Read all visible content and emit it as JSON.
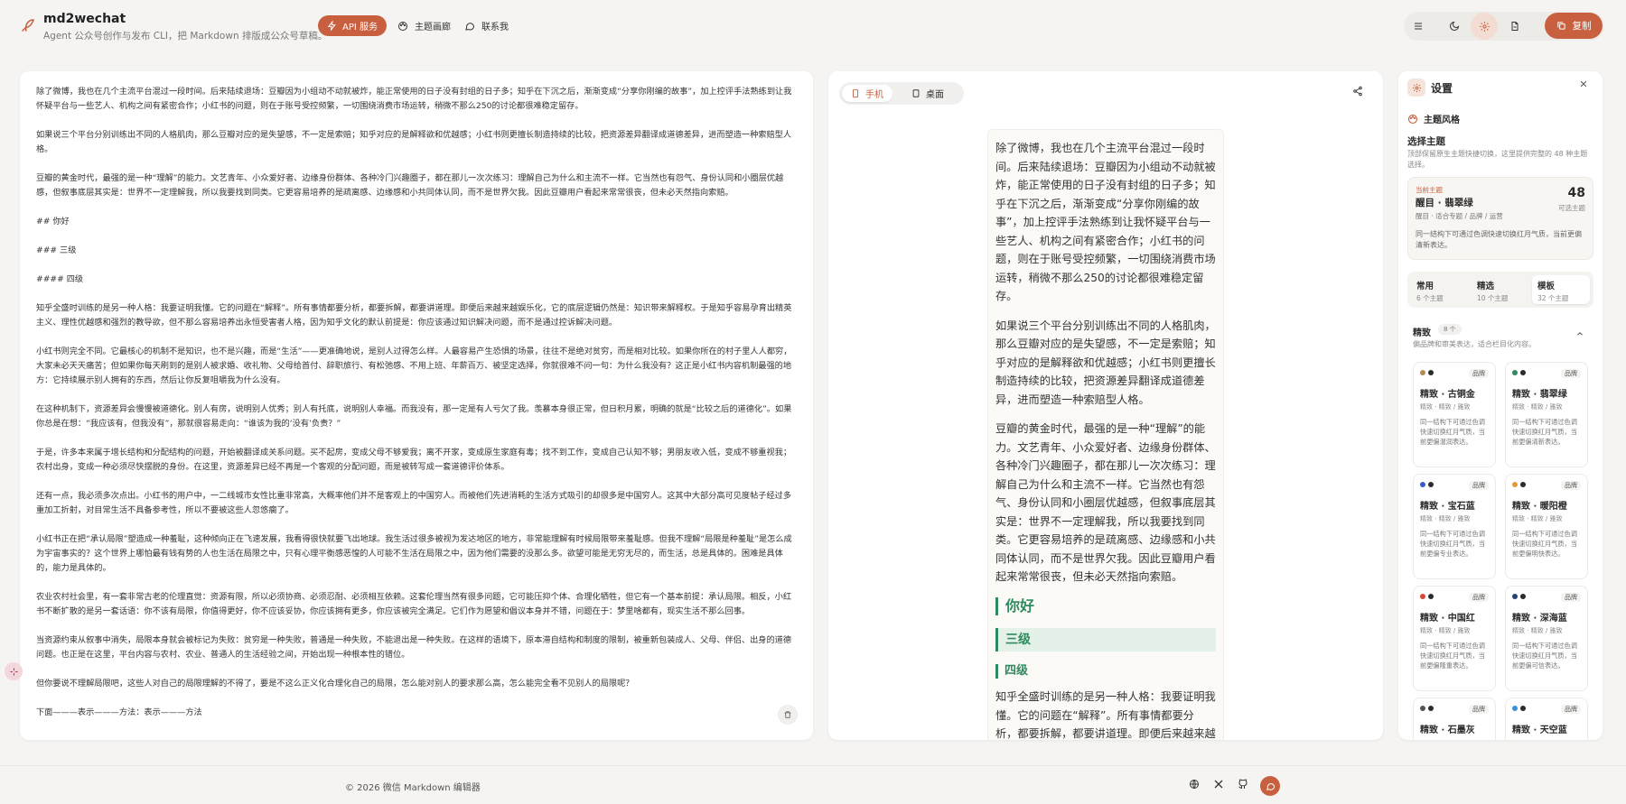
{
  "app": {
    "title": "md2wechat",
    "subtitle": "Agent 公众号创作与发布 CLI，把 Markdown 排版成公众号草稿。"
  },
  "nav": {
    "api": "API 服务",
    "theme_gallery": "主题画廊",
    "contact": "联系我"
  },
  "toolbar": {
    "copy": "复制",
    "icons": [
      "menu-icon",
      "moon-icon",
      "gear-icon",
      "file-icon",
      "copy-icon"
    ]
  },
  "editor": {
    "paragraphs": [
      "除了微博，我也在几个主流平台混过一段时间。后来陆续退场：豆瓣因为小组动不动就被炸，能正常使用的日子没有封组的日子多；知乎在下沉之后，渐渐变成“分享你刚编的故事”，加上控评手法熟练到让我怀疑平台与一些艺人、机构之间有紧密合作；小红书的问题，则在于账号受控频繁，一切围绕消费市场运转，稍微不那么250的讨论都很难稳定留存。",
      "如果说三个平台分别训练出不同的人格肌肉，那么豆瓣对应的是失望感，不一定是索赔；知乎对应的是解释欲和优越感；小红书则更擅长制造持续的比较，把资源差异翻译成道德差异，进而塑造一种索赔型人格。",
      "豆瓣的黄金时代，最强的是一种“理解”的能力。文艺青年、小众爱好者、边缘身份群体、各种冷门兴趣圈子，都在那儿一次次练习：理解自己为什么和主流不一样。它当然也有怨气、身份认同和小圈层优越感，但叙事底层其实是：世界不一定理解我，所以我要找到同类。它更容易培养的是疏离感、边缘感和小共同体认同，而不是世界欠我。因此豆瓣用户看起来常常很丧，但未必天然指向索赔。",
      "## 你好",
      "### 三级",
      "#### 四级",
      "知乎全盛时训练的是另一种人格：我要证明我懂。它的问题在“解释”。所有事情都要分析，都要拆解，都要讲道理。即便后来越来越娱乐化，它的底层逻辑仍然是：知识带来解释权。于是知乎容易孕育出精英主义、理性优越感和强烈的教导欲，但不那么容易培养出永恒受害者人格，因为知乎文化的默认前提是：你应该通过知识解决问题，而不是通过控诉解决问题。",
      "小红书则完全不同。它最核心的机制不是知识，也不是兴趣，而是“生活”——更准确地说，是别人过得怎么样。人最容易产生恐惧的场景，往往不是绝对贫穷，而是相对比较。如果你所在的村子里人人都穷，大家未必天天痛苦；但如果你每天刷到的是别人被求婚、收礼物、父母给首付、辞职旅行、有松弛感、不用上班、年薪百万、被坚定选择，你就很难不问一句：为什么我没有？这正是小红书内容机制最强的地方：它持续展示别人拥有的东西，然后让你反复咀嚼我为什么没有。",
      "在这种机制下，资源差异会慢慢被道德化。别人有房，说明别人优秀；别人有托底，说明别人幸福。而我没有，那一定是有人亏欠了我。羡慕本身很正常，但日积月累，明确的就是“比较之后的道德化”。如果你总是在想：“我应该有，但我没有”，那就很容易走向：“谁该为我的‘没有’负责？”",
      "于是，许多本来属于增长结构和分配结构的问题，开始被翻译成关系问题。买不起房，变成父母不够爱我；离不开家，变成原生家庭有毒；找不到工作，变成自己认知不够；男朋友收入低，变成不够重视我；农村出身，变成一种必须尽快摆脱的身份。在这里，资源差异已经不再是一个客观的分配问题，而是被转写成一套道德评价体系。",
      "还有一点，我必须多次点出。小红书的用户中，一二线城市女性比重非常高，大概率他们并不是客观上的中国穷人。而被他们先进消耗的生活方式吸引的却很多是中国穷人。这其中大部分高可见度帖子经过多重加工折射，对目常生活不具备参考性，所以不要被这些人忽悠瘸了。",
      "小红书正在把“承认局限”塑造成一种羞耻，这种倾向正在飞速发展，我看得很快就要飞出地球。我生活过很多被视为发达地区的地方，非常能理解有时候局限带来羞耻感。但我不理解“局限是种羞耻”是怎么成为宇宙事实的？这个世界上哪怕最有钱有势的人也生活在局限之中，只有心理平衡感恶惶的人可能不生活在局限之中，因为他们需要的没那么多。欲望可能是无穷无尽的，而生活，总是具体的。困难是具体的，能力是具体的。",
      "农业农村社会里，有一套非常古老的伦理直觉：资源有限，所以必须协商、必须忍耐、必须相互依赖。这套伦理当然有很多问题，它可能压抑个体、合理化牺牲，但它有一个基本前提：承认局限。相反，小红书不断扩散的是另一套话语：你不该有局限，你值得更好，你不应该妥协，你应该拥有更多，你应该被完全满足。它们作为愿望和倡议本身并不错，问题在于：梦里啥都有，现实生活不那么回事。",
      "当资源约束从叙事中消失，局限本身就会被标记为失败：贫穷是一种失败，普通是一种失败，不能退出是一种失败。在这样的语境下，原本滞自结构和制度的限制，被重新包装成人、父母、伴侣、出身的道德问题。也正是在这里，平台内容与农村、农业、普通人的生活经验之间，开始出现一种根本性的错位。",
      "但你要说不理解局限吧，这些人对自己的局限理解的不得了，要是不这么正义化合理化自己的局限，怎么能对别人的要求那么高，怎么能完全看不见别人的局限呢？",
      "下面———表示———方法：表示———方法"
    ]
  },
  "preview": {
    "device_mobile": "手机",
    "device_desktop": "桌面",
    "paragraphs_top": [
      "除了微博，我也在几个主流平台混过一段时间。后来陆续退场：豆瓣因为小组动不动就被炸，能正常使用的日子没有封组的日子多；知乎在下沉之后，渐渐变成“分享你刚编的故事”，加上控评手法熟练到让我怀疑平台与一些艺人、机构之间有紧密合作；小红书的问题，则在于账号受控频繁，一切围绕消费市场运转，稍微不那么250的讨论都很难稳定留存。",
      "如果说三个平台分别训练出不同的人格肌肉，那么豆瓣对应的是失望感，不一定是索赔；知乎对应的是解释欲和优越感；小红书则更擅长制造持续的比较，把资源差异翻译成道德差异，进而塑造一种索赔型人格。",
      "豆瓣的黄金时代，最强的是一种“理解”的能力。文艺青年、小众爱好者、边缘身份群体、各种冷门兴趣圈子，都在那儿一次次练习：理解自己为什么和主流不一样。它当然也有怨气、身份认同和小圈层优越感，但叙事底层其实是：世界不一定理解我，所以我要找到同类。它更容易培养的是疏离感、边缘感和小共同体认同，而不是世界欠我。因此豆瓣用户看起来常常很丧，但未必天然指向索赔。"
    ],
    "h2": "你好",
    "h3": "三级",
    "h4": "四级",
    "paragraph_after": "知乎全盛时训练的是另一种人格：我要证明我懂。它的问题在“解释”。所有事情都要分析，都要拆解，都要讲道理。即便后来越来越娱乐化，它的底层逻辑仍然是：知识带来解释权。于是知乎容易孕育出精英主义、理性优越感和强烈的教导欲"
  },
  "settings": {
    "title": "设置",
    "section_title": "主题风格",
    "choose_title": "选择主题",
    "choose_desc": "顶部保留原生主题快捷切换，这里提供完整的 48 种主题选择。",
    "current": {
      "label": "当前主题",
      "name": "醒目 · 翡翠绿",
      "meta": "醒目 · 适合专题 / 品牌 / 运营",
      "count": "48",
      "count_label": "可选主题",
      "desc": "同一结构下可通过色调快速切换红月气质，当前更偏清新表达。"
    },
    "tabs": [
      {
        "label": "常用",
        "count": "6 个主题"
      },
      {
        "label": "精选",
        "count": "10 个主题"
      },
      {
        "label": "模板",
        "count": "32 个主题"
      }
    ],
    "group": {
      "title": "精致",
      "count": "8 个",
      "desc": "偏品牌和审美表达，适合栏目化内容。"
    },
    "cards": [
      {
        "name": "精致 · 古铜金",
        "badge": "品牌",
        "meta": "精致 · 精致 / 雅致",
        "desc": "同一结构下可通过色调快速切换红月气质，当前更偏温润表达。",
        "c1": "#b48a55",
        "c2": "#2b2b2b"
      },
      {
        "name": "精致 · 翡翠绿",
        "badge": "品牌",
        "meta": "精致 · 精致 / 雅致",
        "desc": "同一结构下可通过色调快速切换红月气质，当前更偏清新表达。",
        "c1": "#2f8a5f",
        "c2": "#2b2b2b"
      },
      {
        "name": "精致 · 宝石蓝",
        "badge": "品牌",
        "meta": "精致 · 精致 / 雅致",
        "desc": "同一结构下可通过色调快速切换红月气质，当前更偏专业表达。",
        "c1": "#3a5bc7",
        "c2": "#2b2b2b"
      },
      {
        "name": "精致 · 暖阳橙",
        "badge": "品牌",
        "meta": "精致 · 精致 / 雅致",
        "desc": "同一结构下可通过色调快速切换红月气质，当前更偏明快表达。",
        "c1": "#e39a3b",
        "c2": "#2b2b2b"
      },
      {
        "name": "精致 · 中国红",
        "badge": "品牌",
        "meta": "精致 · 精致 / 雅致",
        "desc": "同一结构下可通过色调快速切换红月气质，当前更偏隆重表达。",
        "c1": "#d9453d",
        "c2": "#2b2b2b"
      },
      {
        "name": "精致 · 深海蓝",
        "badge": "品牌",
        "meta": "精致 · 精致 / 雅致",
        "desc": "同一结构下可通过色调快速切换红月气质，当前更偏可信表达。",
        "c1": "#25456e",
        "c2": "#2b2b2b"
      },
      {
        "name": "精致 · 石墨灰",
        "badge": "品牌",
        "meta": "",
        "desc": "",
        "c1": "#555555",
        "c2": "#2b2b2b"
      },
      {
        "name": "精致 · 天空蓝",
        "badge": "品牌",
        "meta": "",
        "desc": "",
        "c1": "#3c8fd6",
        "c2": "#2b2b2b"
      }
    ]
  },
  "footer": {
    "copyright": "© 2026 微信 Markdown 编辑器",
    "icons": [
      "globe-icon",
      "x-icon",
      "github-icon",
      "chat-icon"
    ]
  },
  "colors": {
    "accent": "#c8603f",
    "theme_green": "#2f8a5f"
  }
}
